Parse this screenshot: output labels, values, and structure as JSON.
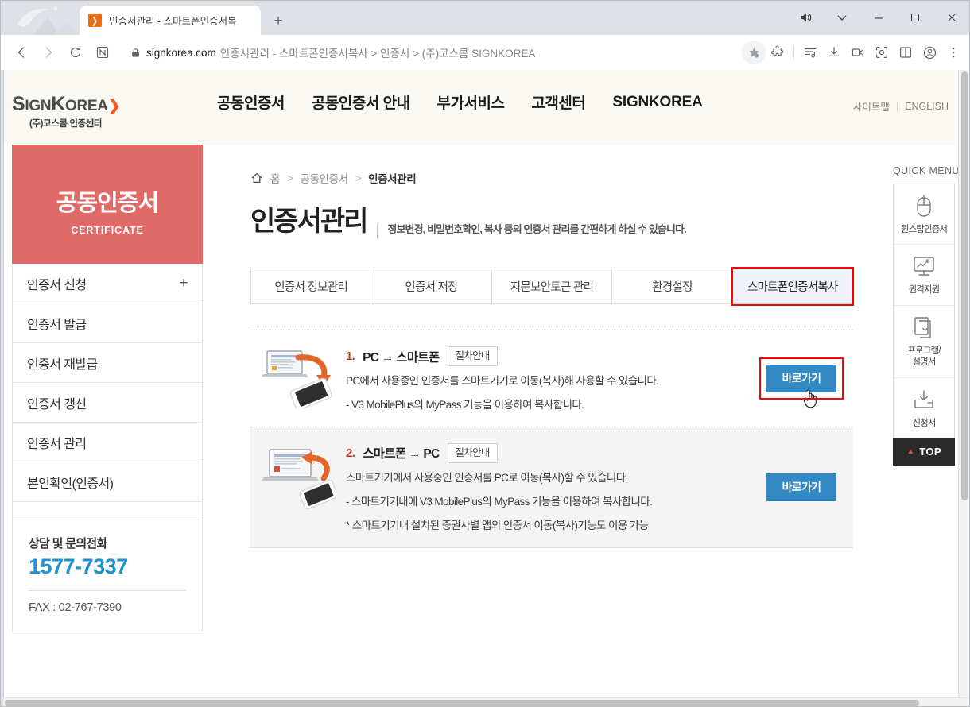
{
  "browser": {
    "tab": {
      "title": "인증서관리 - 스마트폰인증서복",
      "favicon_name": "signkorea-favicon",
      "favicon_glyph": "❯"
    },
    "new_tab_label": "+",
    "omnibox": {
      "domain": "signkorea.com",
      "rest": "인증서관리 - 스마트폰인증서복사 > 인증서 > (주)코스콤 SIGNKOREA"
    },
    "nav_icons": [
      "back-icon",
      "forward-icon",
      "reload-icon",
      "naver-whale-home-icon"
    ],
    "toolbar_icons": [
      "star-bookmark-icon",
      "extensions-puzzle-icon",
      "reading-list-icon",
      "download-icon",
      "video-capture-icon",
      "screenshot-icon",
      "split-screen-icon",
      "profile-icon",
      "more-menu-icon"
    ],
    "window_icons": [
      "volume-icon",
      "chevron-down-icon",
      "minimize-icon",
      "maximize-icon",
      "close-icon"
    ]
  },
  "site": {
    "logo": {
      "mark_main": "S",
      "mark_rest": "IGN",
      "mark_k": "K",
      "mark_orea": "OREA",
      "arrow": "❯",
      "sub": "(주)코스콤 인증센터"
    },
    "gnb": [
      {
        "label": "공동인증서"
      },
      {
        "label": "공동인증서 안내"
      },
      {
        "label": "부가서비스"
      },
      {
        "label": "고객센터"
      },
      {
        "label": "SIGNKOREA"
      }
    ],
    "util": {
      "sitemap": "사이트맵",
      "divider": "|",
      "english": "ENGLISH"
    }
  },
  "sidebar": {
    "head": {
      "kr": "공동인증서",
      "en": "CERTIFICATE"
    },
    "items": [
      {
        "label": "인증서 신청",
        "expand": "+"
      },
      {
        "label": "인증서 발급"
      },
      {
        "label": "인증서 재발급"
      },
      {
        "label": "인증서 갱신"
      },
      {
        "label": "인증서 관리"
      },
      {
        "label": "본인확인(인증서)"
      }
    ],
    "contact": {
      "heading": "상담 및 문의전화",
      "phone": "1577-7337",
      "fax": "FAX : 02-767-7390"
    }
  },
  "main": {
    "breadcrumb": {
      "home_icon": "home-icon",
      "home": "홈",
      "sep1": ">",
      "level2": "공동인증서",
      "sep2": ">",
      "current": "인증서관리"
    },
    "title": "인증서관리",
    "description": "정보변경, 비밀번호확인, 복사 등의 인증서 관리를 간편하게 하실 수 있습니다.",
    "tabs": [
      {
        "label": "인증서 정보관리",
        "selected": false
      },
      {
        "label": "인증서 저장",
        "selected": false
      },
      {
        "label": "지문보안토큰 관리",
        "selected": false
      },
      {
        "label": "환경설정",
        "selected": false
      },
      {
        "label": "스마트폰인증서복사",
        "selected": true
      }
    ],
    "rows": [
      {
        "num": "1.",
        "title": "PC → 스마트폰",
        "guide_label": "절차안내",
        "lines": [
          "PC에서 사용중인 인증서를 스마트기기로 이동(복사)해 사용할 수 있습니다.",
          "- V3 MobilePlus의 MyPass 기능을 이용하여 복사합니다."
        ],
        "cta": "바로가기",
        "icon_name": "laptop-to-phone-icon",
        "highlighted": true
      },
      {
        "num": "2.",
        "title": "스마트폰 → PC",
        "guide_label": "절차안내",
        "lines": [
          "스마트기기에서 사용중인 인증서를 PC로 이동(복사)할 수 있습니다.",
          "- 스마트기기내에 V3 MobilePlus의 MyPass 기능을 이용하여 복사합니다.",
          "* 스마트기기내 설치된 증권사별 앱의 인증서 이동(복사)기능도 이용 가능"
        ],
        "cta": "바로가기",
        "icon_name": "phone-to-laptop-icon",
        "highlighted": false
      }
    ]
  },
  "quick_menu": {
    "title": "QUICK MENU",
    "items": [
      {
        "label": "원스탑인증서",
        "icon": "mouse-icon"
      },
      {
        "label": "원격지원",
        "icon": "monitor-chart-icon"
      },
      {
        "label": "프로그램/\n설명서",
        "icon": "documents-download-icon"
      },
      {
        "label": "신청서",
        "icon": "inbox-download-icon"
      }
    ],
    "top": {
      "label": "TOP",
      "caret": "▲"
    }
  },
  "colors": {
    "sidebar_red": "#E06A68",
    "cta_blue": "#3389C4",
    "highlight_red": "#FF0000",
    "phone_blue": "#1F93D1",
    "header_bg": "#FAF8F2",
    "accent_orange": "#F05A1E"
  }
}
